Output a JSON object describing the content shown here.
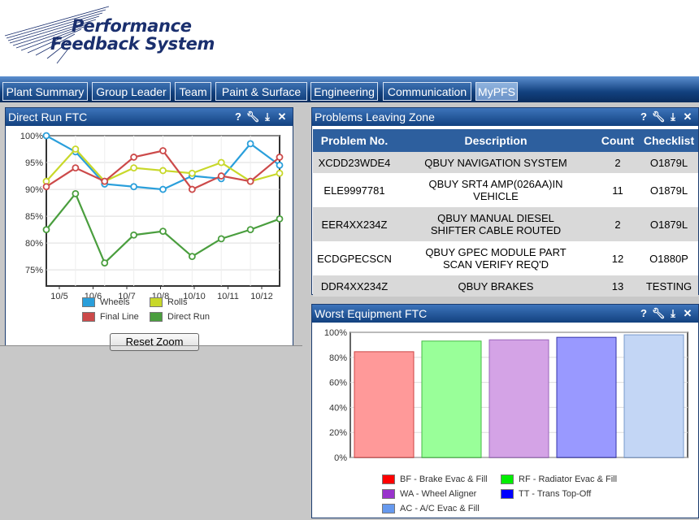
{
  "app": {
    "logo_line1": "Performance",
    "logo_line2": "Feedback System"
  },
  "nav": {
    "tabs": [
      {
        "label": "Plant Summary",
        "active": false
      },
      {
        "label": "Group Leader",
        "active": false
      },
      {
        "label": "Team",
        "active": false
      },
      {
        "label": "Paint & Surface",
        "active": false
      },
      {
        "label": "Engineering",
        "active": false
      },
      {
        "label": "Communication",
        "active": false
      },
      {
        "label": "MyPFS",
        "active": true
      }
    ]
  },
  "panel_icons": {
    "help": "?",
    "settings": "wrench-icon",
    "download": "download-icon",
    "close": "×"
  },
  "direct_run": {
    "title": "Direct Run FTC",
    "reset_zoom": "Reset Zoom",
    "chart_data": {
      "type": "line",
      "x": [
        "10/5",
        "10/6",
        "10/7",
        "10/8",
        "10/10",
        "10/11",
        "10/12"
      ],
      "ylim": [
        72,
        100
      ],
      "yticks": [
        "100%",
        "95%",
        "90%",
        "85%",
        "80%",
        "75%"
      ],
      "grid": true,
      "legend": "bottom",
      "series": [
        {
          "name": "Wheels",
          "color": "#2a9fdb",
          "values": [
            100,
            97,
            91,
            90.5,
            90,
            92.5,
            92,
            98.5,
            94.5
          ]
        },
        {
          "name": "Rolls",
          "color": "#c8d82a",
          "values": [
            91.5,
            97.5,
            91.5,
            94,
            93.5,
            93,
            95,
            91.5,
            93
          ]
        },
        {
          "name": "Final Line",
          "color": "#cc4a4a",
          "values": [
            90.5,
            94,
            91.5,
            96,
            97.2,
            90,
            92.5,
            91.5,
            96
          ]
        },
        {
          "name": "Direct Run",
          "color": "#4a9e3e",
          "values": [
            82.5,
            89.2,
            76.3,
            81.5,
            82.2,
            77.5,
            80.8,
            82.5,
            84.5
          ]
        }
      ]
    }
  },
  "problems": {
    "title": "Problems Leaving Zone",
    "headers": [
      "Problem No.",
      "Description",
      "Count",
      "Checklist"
    ],
    "rows": [
      [
        "XCDD23WDE4",
        "QBUY NAVIGATION SYSTEM",
        "2",
        "O1879L"
      ],
      [
        "ELE9997781",
        "QBUY SRT4 AMP(026AA)IN VEHICLE",
        "11",
        "O1879L"
      ],
      [
        "EER4XX234Z",
        "QBUY MANUAL DIESEL SHIFTER CABLE ROUTED",
        "2",
        "O1879L"
      ],
      [
        "ECDGPECSCN",
        "QBUY GPEC MODULE PART SCAN VERIFY REQ'D",
        "12",
        "O1880P"
      ],
      [
        "DDR4XX234Z",
        "QBUY BRAKES",
        "13",
        "TESTING"
      ]
    ]
  },
  "worst_equipment": {
    "title": "Worst Equipment FTC",
    "chart_data": {
      "type": "bar",
      "ylim": [
        0,
        100
      ],
      "yticks": [
        "100%",
        "80%",
        "60%",
        "40%",
        "20%",
        "0%"
      ],
      "grid": true,
      "legend": "bottom",
      "categories": [
        "BF - Brake Evac & Fill",
        "RF - Radiator Evac & Fill",
        "WA - Wheel Aligner",
        "TT - Trans Top-Off",
        "AC - A/C Evac & Fill"
      ],
      "values": [
        84.5,
        93,
        94,
        96,
        98
      ],
      "fill_colors": [
        "#ff9999",
        "#99ff99",
        "#d4a3e6",
        "#9999ff",
        "#c3d6f5"
      ],
      "stroke_colors": [
        "#cc4444",
        "#44bb44",
        "#9966bb",
        "#3333aa",
        "#7799cc"
      ],
      "legend_colors": [
        "#ff0000",
        "#00ee00",
        "#9933cc",
        "#0000ff",
        "#6699ee"
      ]
    }
  }
}
